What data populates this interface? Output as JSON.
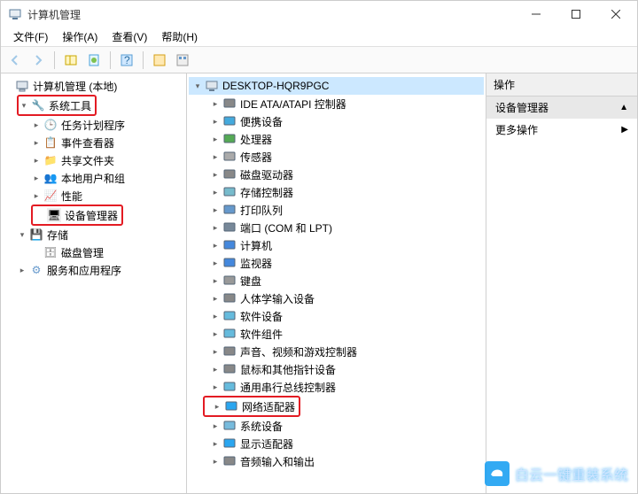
{
  "window": {
    "title": "计算机管理"
  },
  "menus": {
    "file": "文件(F)",
    "action": "操作(A)",
    "view": "查看(V)",
    "help": "帮助(H)"
  },
  "left_tree": {
    "root": "计算机管理 (本地)",
    "system_tools": "系统工具",
    "task_scheduler": "任务计划程序",
    "event_viewer": "事件查看器",
    "shared_folders": "共享文件夹",
    "local_users": "本地用户和组",
    "performance": "性能",
    "device_manager": "设备管理器",
    "storage": "存储",
    "disk_management": "磁盘管理",
    "services_apps": "服务和应用程序"
  },
  "mid_tree": {
    "root": "DESKTOP-HQR9PGC",
    "items": [
      "IDE ATA/ATAPI 控制器",
      "便携设备",
      "处理器",
      "传感器",
      "磁盘驱动器",
      "存储控制器",
      "打印队列",
      "端口 (COM 和 LPT)",
      "计算机",
      "监视器",
      "键盘",
      "人体学输入设备",
      "软件设备",
      "软件组件",
      "声音、视频和游戏控制器",
      "鼠标和其他指针设备",
      "通用串行总线控制器",
      "网络适配器",
      "系统设备",
      "显示适配器",
      "音频输入和输出"
    ]
  },
  "right_panel": {
    "header": "操作",
    "group": "设备管理器",
    "more": "更多操作"
  },
  "watermark": {
    "text": "白云一键重装系统",
    "url": "www.baiyunxitong.com"
  },
  "colors": {
    "highlight_border": "#e31b23",
    "selection": "#cce8ff"
  }
}
